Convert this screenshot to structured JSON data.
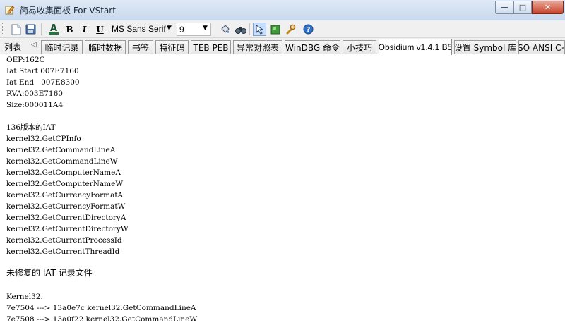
{
  "window": {
    "title": "简易收集面板 For VStart",
    "min_glyph": "—",
    "max_glyph": "□",
    "close_glyph": "✕"
  },
  "toolbar": {
    "bold": "B",
    "italic": "I",
    "underline": "U",
    "font_color_glyph": "A",
    "font_name": "MS Sans Serif",
    "font_size": "9",
    "arrow_glyph": "▼"
  },
  "tabs": {
    "lead_label": "列表",
    "lead_arrow": "◁",
    "items": [
      "临时记录",
      "临时数据",
      "书签",
      "特征码",
      "TEB PEB",
      "异常对照表",
      "WinDBG 命令",
      "小技巧",
      "Obsidium v1.4.1 B5",
      "设置 Symbol 库",
      "ISO ANSI C+"
    ],
    "active_index": 8
  },
  "content": {
    "lines": [
      "OEP:162C",
      "Iat Start 007E7160",
      "Iat End   007E8300",
      "RVA:003E7160",
      "Size:000011A4",
      "",
      "136版本的IAT",
      "kernel32.GetCPInfo",
      "kernel32.GetCommandLineA",
      "kernel32.GetCommandLineW",
      "kernel32.GetComputerNameA",
      "kernel32.GetComputerNameW",
      "kernel32.GetCurrencyFormatA",
      "kernel32.GetCurrencyFormatW",
      "kernel32.GetCurrentDirectoryA",
      "kernel32.GetCurrentDirectoryW",
      "kernel32.GetCurrentProcessId",
      "kernel32.GetCurrentThreadId",
      "",
      "未修复的 IAT 记录文件",
      "",
      "Kernel32.",
      "7e7504 ---> 13a0e7c kernel32.GetCommandLineA",
      "7e7508 ---> 13a0f22 kernel32.GetCommandLineW"
    ]
  }
}
